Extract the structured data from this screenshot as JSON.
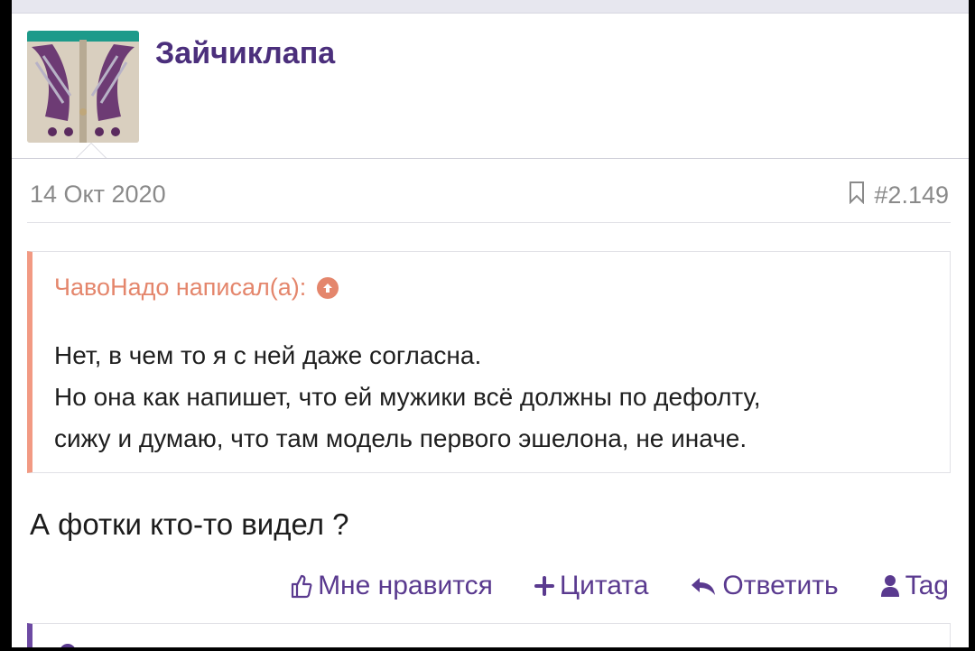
{
  "post": {
    "author": "Зайчиклапа",
    "date": "14 Окт 2020",
    "number": "#2.149",
    "quote": {
      "author_line": "ЧавоНадо написал(а):",
      "lines": [
        "Нет, в чем то я с ней даже согласна.",
        "Но она как напишет, что ей мужики всё должны по дефолту,",
        "сижу и думаю, что там модель первого эшелона, не иначе."
      ]
    },
    "message": "А фотки кто-то видел ?",
    "actions": {
      "like": "Мне нравится",
      "quote": "Цитата",
      "reply": "Ответить",
      "tag": "Tag"
    }
  },
  "icons": {
    "like": "thumbs-up-icon",
    "quote": "plus-icon",
    "reply": "reply-arrow-icon",
    "tag": "user-icon",
    "bookmark": "bookmark-icon",
    "quote_jump": "arrow-up-circle-icon"
  },
  "colors": {
    "username": "#4b2f7c",
    "quote_accent": "#f29a83",
    "action": "#5a3a8f",
    "meta": "#8a8a8a"
  }
}
